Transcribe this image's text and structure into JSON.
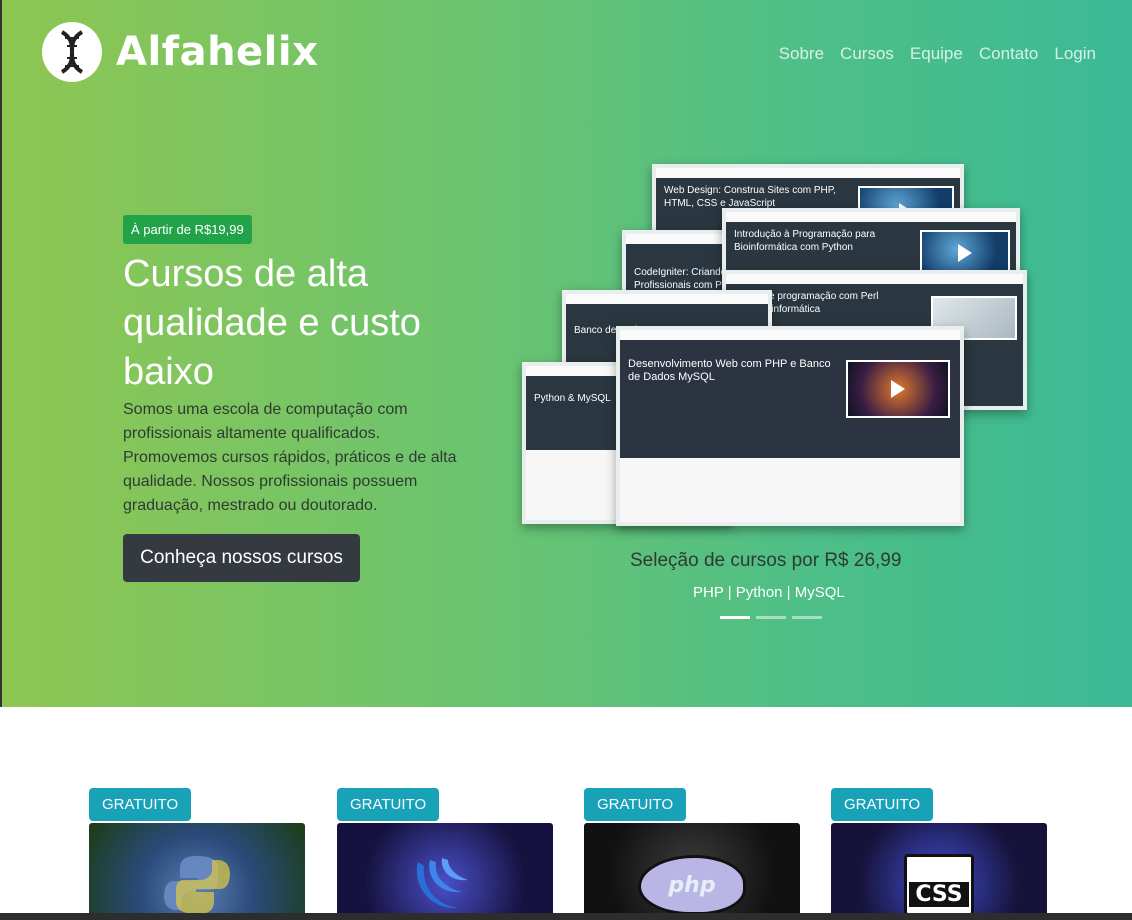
{
  "brand": {
    "name": "Alfahelix",
    "logo_icon": "dna-helix-icon"
  },
  "nav": {
    "items": [
      "Sobre",
      "Cursos",
      "Equipe",
      "Contato",
      "Login"
    ]
  },
  "hero": {
    "price_badge": "À partir de R$19,99",
    "headline": "Cursos de alta qualidade e custo baixo",
    "lead": "Somos uma escola de computação com profissionais altamente qualificados. Promovemos cursos rápidos, práticos e de alta qualidade. Nossos profissionais possuem graduação, mestrado ou doutorado.",
    "cta": "Conheça nossos cursos"
  },
  "carousel": {
    "screens": [
      "Web Design: Construa Sites com PHP, HTML, CSS e JavaScript",
      "Introdução à Programação para Bioinformática com Python",
      "CodeIgniter: Criando W... Profissionais com PHP",
      "Curso de programação com Perl para Bioinformática",
      "Banco de Dados MySQL",
      "Python & MySQL",
      "Desenvolvimento Web com PHP e Banco de Dados MySQL"
    ],
    "caption_title": "Seleção de cursos por R$ 26,99",
    "caption_sub": "PHP | Python | MySQL",
    "slides": 3,
    "active_slide": 1
  },
  "courses": [
    {
      "badge": "GRATUITO",
      "icon": "python-logo-icon"
    },
    {
      "badge": "GRATUITO",
      "icon": "jquery-logo-icon"
    },
    {
      "badge": "GRATUITO",
      "icon": "php-elephant-icon",
      "image_text": "php"
    },
    {
      "badge": "GRATUITO",
      "icon": "css-file-icon",
      "image_text": "CSS"
    }
  ],
  "colors": {
    "hero_left": "#8ec652",
    "hero_right": "#3bba97",
    "badge_green": "#22a34a",
    "gratuito": "#17a2b8",
    "cta_bg": "#343a40"
  }
}
